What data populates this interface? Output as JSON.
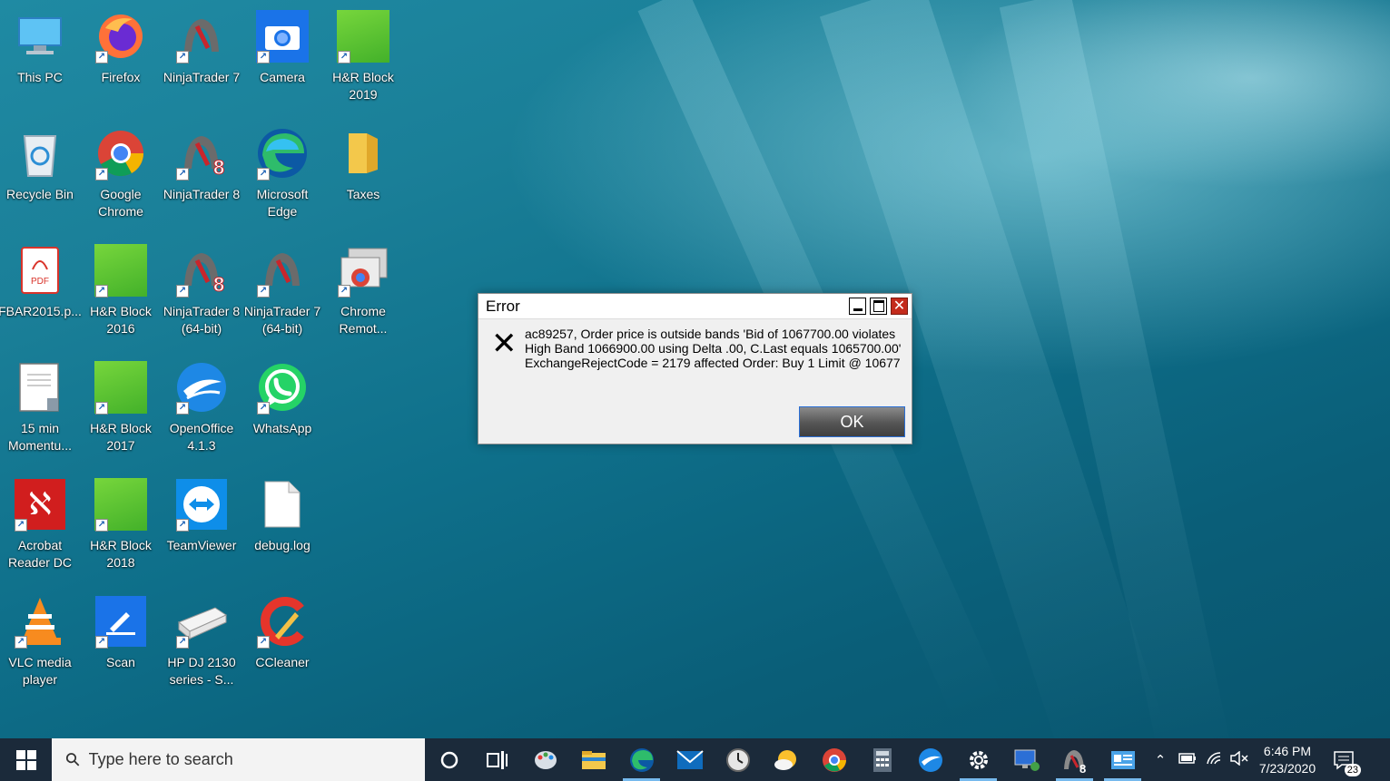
{
  "desktop_icons": [
    {
      "label": "This PC",
      "icon": "this-pc-icon"
    },
    {
      "label": "Firefox",
      "icon": "firefox-icon"
    },
    {
      "label": "NinjaTrader 7",
      "icon": "ninjatrader-icon"
    },
    {
      "label": "Camera",
      "icon": "camera-icon"
    },
    {
      "label": "H&R Block 2019",
      "icon": "hr-block-icon"
    },
    {
      "label": "Recycle Bin",
      "icon": "recycle-bin-icon"
    },
    {
      "label": "Google Chrome",
      "icon": "chrome-icon"
    },
    {
      "label": "NinjaTrader 8",
      "icon": "ninjatrader-8-icon"
    },
    {
      "label": "Microsoft Edge",
      "icon": "edge-icon"
    },
    {
      "label": "Taxes",
      "icon": "folder-icon"
    },
    {
      "label": "FBAR2015.p...",
      "icon": "pdf-icon"
    },
    {
      "label": "H&R Block 2016",
      "icon": "hr-block-icon"
    },
    {
      "label": "NinjaTrader 8 (64-bit)",
      "icon": "ninjatrader-8-icon"
    },
    {
      "label": "NinjaTrader 7 (64-bit)",
      "icon": "ninjatrader-icon"
    },
    {
      "label": "Chrome Remot...",
      "icon": "chrome-remote-icon"
    },
    {
      "label": "15 min Momentu...",
      "icon": "document-icon"
    },
    {
      "label": "H&R Block 2017",
      "icon": "hr-block-icon"
    },
    {
      "label": "OpenOffice 4.1.3",
      "icon": "openoffice-icon"
    },
    {
      "label": "WhatsApp",
      "icon": "whatsapp-icon"
    },
    {
      "label": "Acrobat Reader DC",
      "icon": "acrobat-icon"
    },
    {
      "label": "H&R Block 2018",
      "icon": "hr-block-icon"
    },
    {
      "label": "TeamViewer",
      "icon": "teamviewer-icon"
    },
    {
      "label": "debug.log",
      "icon": "file-icon"
    },
    {
      "label": "VLC media player",
      "icon": "vlc-icon"
    },
    {
      "label": "Scan",
      "icon": "scan-icon"
    },
    {
      "label": "HP DJ 2130 series - S...",
      "icon": "printer-icon"
    },
    {
      "label": "CCleaner",
      "icon": "ccleaner-icon"
    }
  ],
  "dialog": {
    "title": "Error",
    "message": "ac89257, Order price is outside bands 'Bid of 1067700.00 violates High Band 1066900.00 using Delta .00, C.Last equals 1065700.00' ExchangeRejectCode = 2179 affected Order: Buy 1 Limit @ 10677",
    "ok_label": "OK",
    "close_glyph": "✕",
    "error_glyph": "✕"
  },
  "taskbar": {
    "search_placeholder": "Type here to search",
    "time": "6:46 PM",
    "date": "7/23/2020",
    "notification_count": "23",
    "pinned": [
      "cortana-icon",
      "task-view-icon",
      "paint-icon",
      "file-explorer-icon",
      "edge-icon",
      "mail-icon",
      "clock-app-icon",
      "weather-icon",
      "chrome-icon",
      "calculator-icon",
      "openoffice-icon",
      "settings-icon",
      "remote-desktop-icon",
      "ninjatrader-8-icon",
      "control-panel-icon"
    ]
  },
  "colors": {
    "taskbar_bg": "#1b2a3a",
    "close_red": "#c42b1c",
    "accent_blue": "#76b9ed"
  }
}
